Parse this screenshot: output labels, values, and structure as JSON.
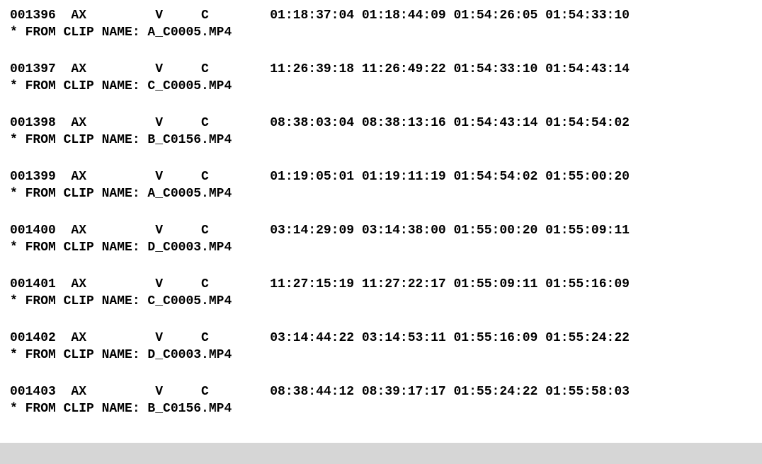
{
  "clip_label_prefix": "* FROM CLIP NAME: ",
  "events": [
    {
      "num": "001396",
      "reel": "AX",
      "track": "V",
      "ttype": "C",
      "src_in": "01:18:37:04",
      "src_out": "01:18:44:09",
      "rec_in": "01:54:26:05",
      "rec_out": "01:54:33:10",
      "clip": "A_C0005.MP4"
    },
    {
      "num": "001397",
      "reel": "AX",
      "track": "V",
      "ttype": "C",
      "src_in": "11:26:39:18",
      "src_out": "11:26:49:22",
      "rec_in": "01:54:33:10",
      "rec_out": "01:54:43:14",
      "clip": "C_C0005.MP4"
    },
    {
      "num": "001398",
      "reel": "AX",
      "track": "V",
      "ttype": "C",
      "src_in": "08:38:03:04",
      "src_out": "08:38:13:16",
      "rec_in": "01:54:43:14",
      "rec_out": "01:54:54:02",
      "clip": "B_C0156.MP4"
    },
    {
      "num": "001399",
      "reel": "AX",
      "track": "V",
      "ttype": "C",
      "src_in": "01:19:05:01",
      "src_out": "01:19:11:19",
      "rec_in": "01:54:54:02",
      "rec_out": "01:55:00:20",
      "clip": "A_C0005.MP4"
    },
    {
      "num": "001400",
      "reel": "AX",
      "track": "V",
      "ttype": "C",
      "src_in": "03:14:29:09",
      "src_out": "03:14:38:00",
      "rec_in": "01:55:00:20",
      "rec_out": "01:55:09:11",
      "clip": "D_C0003.MP4"
    },
    {
      "num": "001401",
      "reel": "AX",
      "track": "V",
      "ttype": "C",
      "src_in": "11:27:15:19",
      "src_out": "11:27:22:17",
      "rec_in": "01:55:09:11",
      "rec_out": "01:55:16:09",
      "clip": "C_C0005.MP4"
    },
    {
      "num": "001402",
      "reel": "AX",
      "track": "V",
      "ttype": "C",
      "src_in": "03:14:44:22",
      "src_out": "03:14:53:11",
      "rec_in": "01:55:16:09",
      "rec_out": "01:55:24:22",
      "clip": "D_C0003.MP4"
    },
    {
      "num": "001403",
      "reel": "AX",
      "track": "V",
      "ttype": "C",
      "src_in": "08:38:44:12",
      "src_out": "08:39:17:17",
      "rec_in": "01:55:24:22",
      "rec_out": "01:55:58:03",
      "clip": "B_C0156.MP4"
    }
  ]
}
